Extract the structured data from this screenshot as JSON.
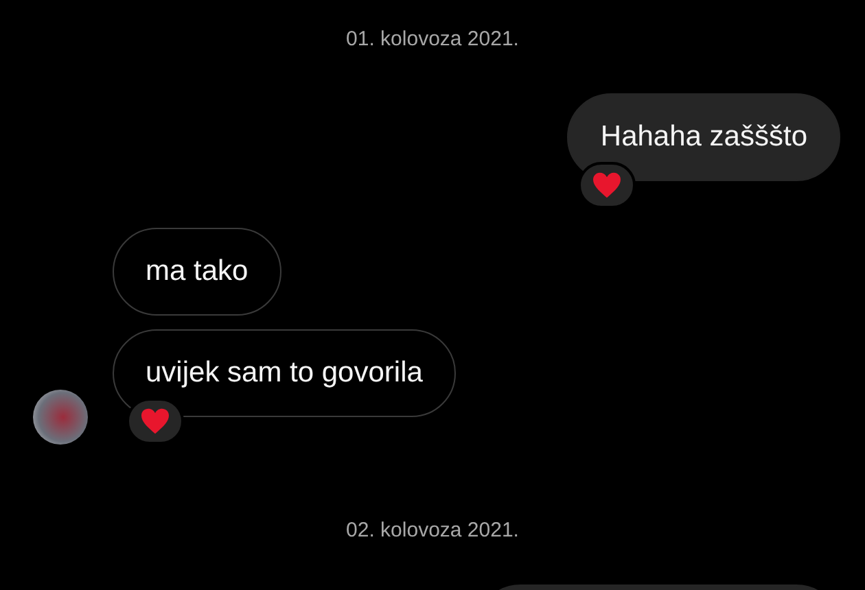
{
  "items": [
    {
      "kind": "date",
      "text": "01. kolovoza 2021."
    },
    {
      "kind": "outgoing",
      "messages": [
        {
          "text": "Hahaha zašššto",
          "reaction": true
        }
      ]
    },
    {
      "kind": "incoming",
      "avatar": true,
      "messages": [
        {
          "text": "ma tako",
          "reaction": false
        },
        {
          "text": "uvijek sam to govorila",
          "reaction": true
        }
      ]
    },
    {
      "kind": "date",
      "text": "02. kolovoza 2021."
    },
    {
      "kind": "outgoing",
      "messages": [
        {
          "reaction": false
        }
      ]
    }
  ]
}
